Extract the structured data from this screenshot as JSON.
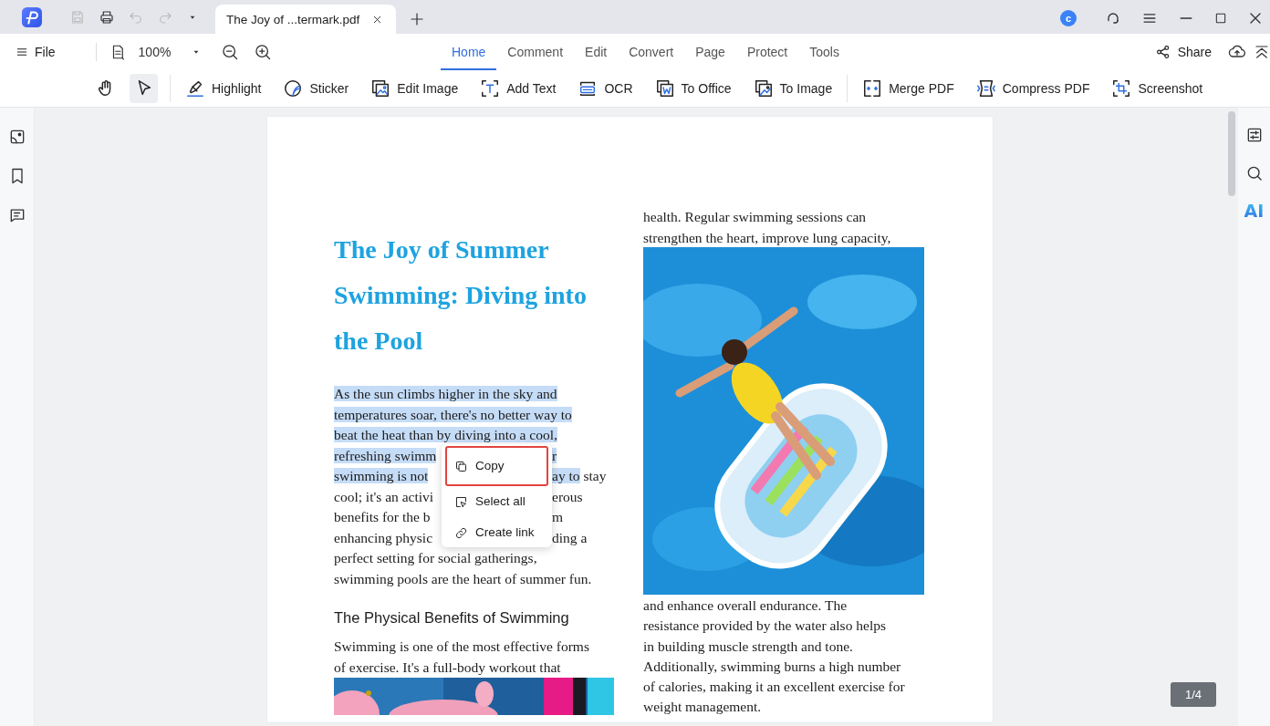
{
  "title_bar": {
    "quick_actions": [
      {
        "disabled": true
      },
      {
        "disabled": false
      },
      {
        "disabled": true
      },
      {
        "disabled": true
      }
    ],
    "tab": {
      "title": "The Joy of ...termark.pdf"
    },
    "avatar": "c"
  },
  "menu_bar": {
    "file": "File",
    "zoom": "100%",
    "tabs": [
      {
        "label": "Home",
        "selected": true
      },
      {
        "label": "Comment",
        "selected": false
      },
      {
        "label": "Edit",
        "selected": false
      },
      {
        "label": "Convert",
        "selected": false
      },
      {
        "label": "Page",
        "selected": false
      },
      {
        "label": "Protect",
        "selected": false
      },
      {
        "label": "Tools",
        "selected": false
      }
    ],
    "share": "Share"
  },
  "toolbar": {
    "modes": [
      {
        "selected": false
      },
      {
        "selected": true
      }
    ],
    "tools": [
      {
        "label": "Highlight"
      },
      {
        "label": "Sticker"
      },
      {
        "label": "Edit Image"
      },
      {
        "label": "Add Text"
      },
      {
        "label": "OCR"
      },
      {
        "label": "To Office"
      },
      {
        "label": "To Image"
      },
      {
        "label": "Merge PDF"
      },
      {
        "label": "Compress PDF"
      },
      {
        "label": "Screenshot"
      }
    ]
  },
  "right_sidebar": {
    "ai_label": "AI"
  },
  "document": {
    "title_lines": [
      "The Joy of Summer",
      "Swimming: Diving into",
      "the Pool"
    ],
    "paragraph": [
      {
        "left": [
          {
            "text": "As the sun climbs higher in the sky and",
            "highlighted": true
          }
        ]
      },
      {
        "left": [
          {
            "text": "temperatures soar, there's no better way to",
            "highlighted": true
          }
        ]
      },
      {
        "left": [
          {
            "text": "beat the heat than by diving into a cool,",
            "highlighted": true
          }
        ]
      },
      {
        "left": [
          {
            "text": "refreshing swimm",
            "highlighted": true
          }
        ],
        "right": [
          {
            "text": "r",
            "highlighted": true
          }
        ]
      },
      {
        "left": [
          {
            "text": "swimming is not",
            "highlighted": true
          }
        ],
        "right": [
          {
            "text": "ay to",
            "highlighted": true
          },
          {
            "text": " stay",
            "highlighted": false
          }
        ]
      },
      {
        "left": [
          {
            "text": "cool; it's an activi",
            "highlighted": false
          }
        ],
        "right": [
          {
            "text": "erous",
            "highlighted": false
          }
        ]
      },
      {
        "left": [
          {
            "text": "benefits for the b",
            "highlighted": false
          }
        ],
        "right": [
          {
            "text": "m",
            "highlighted": false
          }
        ]
      },
      {
        "left": [
          {
            "text": "enhancing physic",
            "highlighted": false
          }
        ],
        "right": [
          {
            "text": "ding a",
            "highlighted": false
          }
        ]
      },
      {
        "left": [
          {
            "text": "perfect setting for social gatherings,",
            "highlighted": false
          }
        ]
      },
      {
        "left": [
          {
            "text": "swimming pools are the heart of summer fun.",
            "highlighted": false
          }
        ]
      }
    ],
    "heading": "The Physical Benefits of Swimming",
    "paragraph_2": [
      "Swimming is one of the most effective forms",
      "of exercise. It's a full-body workout that"
    ],
    "right_top": [
      "health. Regular swimming sessions can",
      "strengthen the heart, improve lung capacity,"
    ],
    "right_bottom": [
      "and enhance overall endurance. The",
      "resistance provided by the water also helps",
      "in building muscle strength and tone.",
      "Additionally, swimming burns a high number",
      "of calories, making it an excellent exercise for",
      "weight management."
    ]
  },
  "context_menu": [
    {
      "label": "Copy",
      "selected": true
    },
    {
      "label": "Select all",
      "selected": false
    },
    {
      "label": "Create link",
      "selected": false
    }
  ],
  "page_indicator": "1/4"
}
